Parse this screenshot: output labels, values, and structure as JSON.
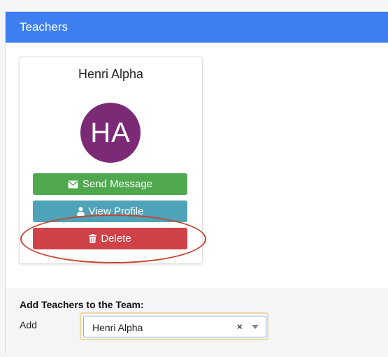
{
  "panel": {
    "title": "Teachers"
  },
  "teacher_card": {
    "name": "Henri Alpha",
    "avatar_initials": "HA",
    "avatar_color": "#7c2a75",
    "buttons": {
      "send_message": "Send Message",
      "view_profile": "View Profile",
      "delete": "Delete"
    }
  },
  "add_section": {
    "title": "Add Teachers to the Team:",
    "label": "Add",
    "select": {
      "value": "Henri Alpha",
      "clear": "×"
    }
  },
  "colors": {
    "header": "#3d7ff0",
    "send": "#4fa84e",
    "view": "#4ea3b8",
    "delete": "#cf4248",
    "annotation": "#c8442e"
  }
}
